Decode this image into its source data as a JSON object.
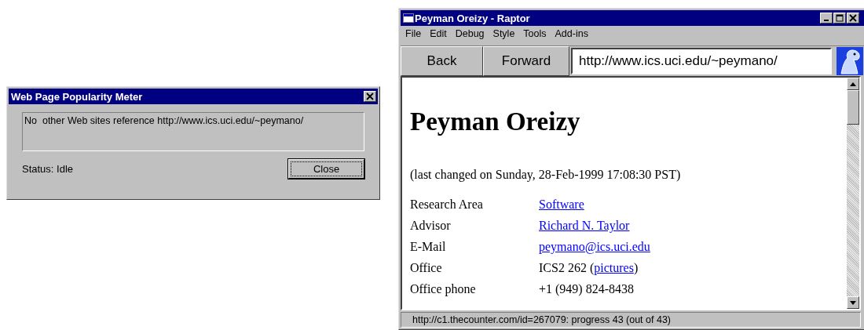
{
  "dialog": {
    "title": "Web Page Popularity Meter",
    "message": "No  other Web sites reference http://www.ics.uci.edu/~peymano/",
    "status": "Status: Idle",
    "buttons": [
      "Close"
    ]
  },
  "browser": {
    "title": "Peyman Oreizy - Raptor",
    "menu": [
      "File",
      "Edit",
      "Debug",
      "Style",
      "Tools",
      "Add-ins"
    ],
    "nav_buttons": [
      "Back",
      "Forward"
    ],
    "address": "http://www.ics.uci.edu/~peymano/",
    "page": {
      "heading": "Peyman Oreizy",
      "last_changed": "(last changed on Sunday, 28-Feb-1999 17:08:30 PST)",
      "rows": [
        {
          "label": "Research Area",
          "value": [
            {
              "text": "Software",
              "link": true
            }
          ]
        },
        {
          "label": "Advisor",
          "value": [
            {
              "text": "Richard N. Taylor",
              "link": true
            }
          ]
        },
        {
          "label": "E-Mail",
          "value": [
            {
              "text": "peymano@ics.uci.edu",
              "link": true
            }
          ]
        },
        {
          "label": "Office",
          "value": [
            {
              "text": "ICS2 262 (",
              "link": false
            },
            {
              "text": "pictures",
              "link": true
            },
            {
              "text": ")",
              "link": false
            }
          ]
        },
        {
          "label": "Office phone",
          "value": [
            {
              "text": "+1 (949) 824-8438",
              "link": false
            }
          ]
        }
      ]
    },
    "status_bar": "http://c1.thecounter.com/id=267079: progress 43 (out of 43)"
  }
}
